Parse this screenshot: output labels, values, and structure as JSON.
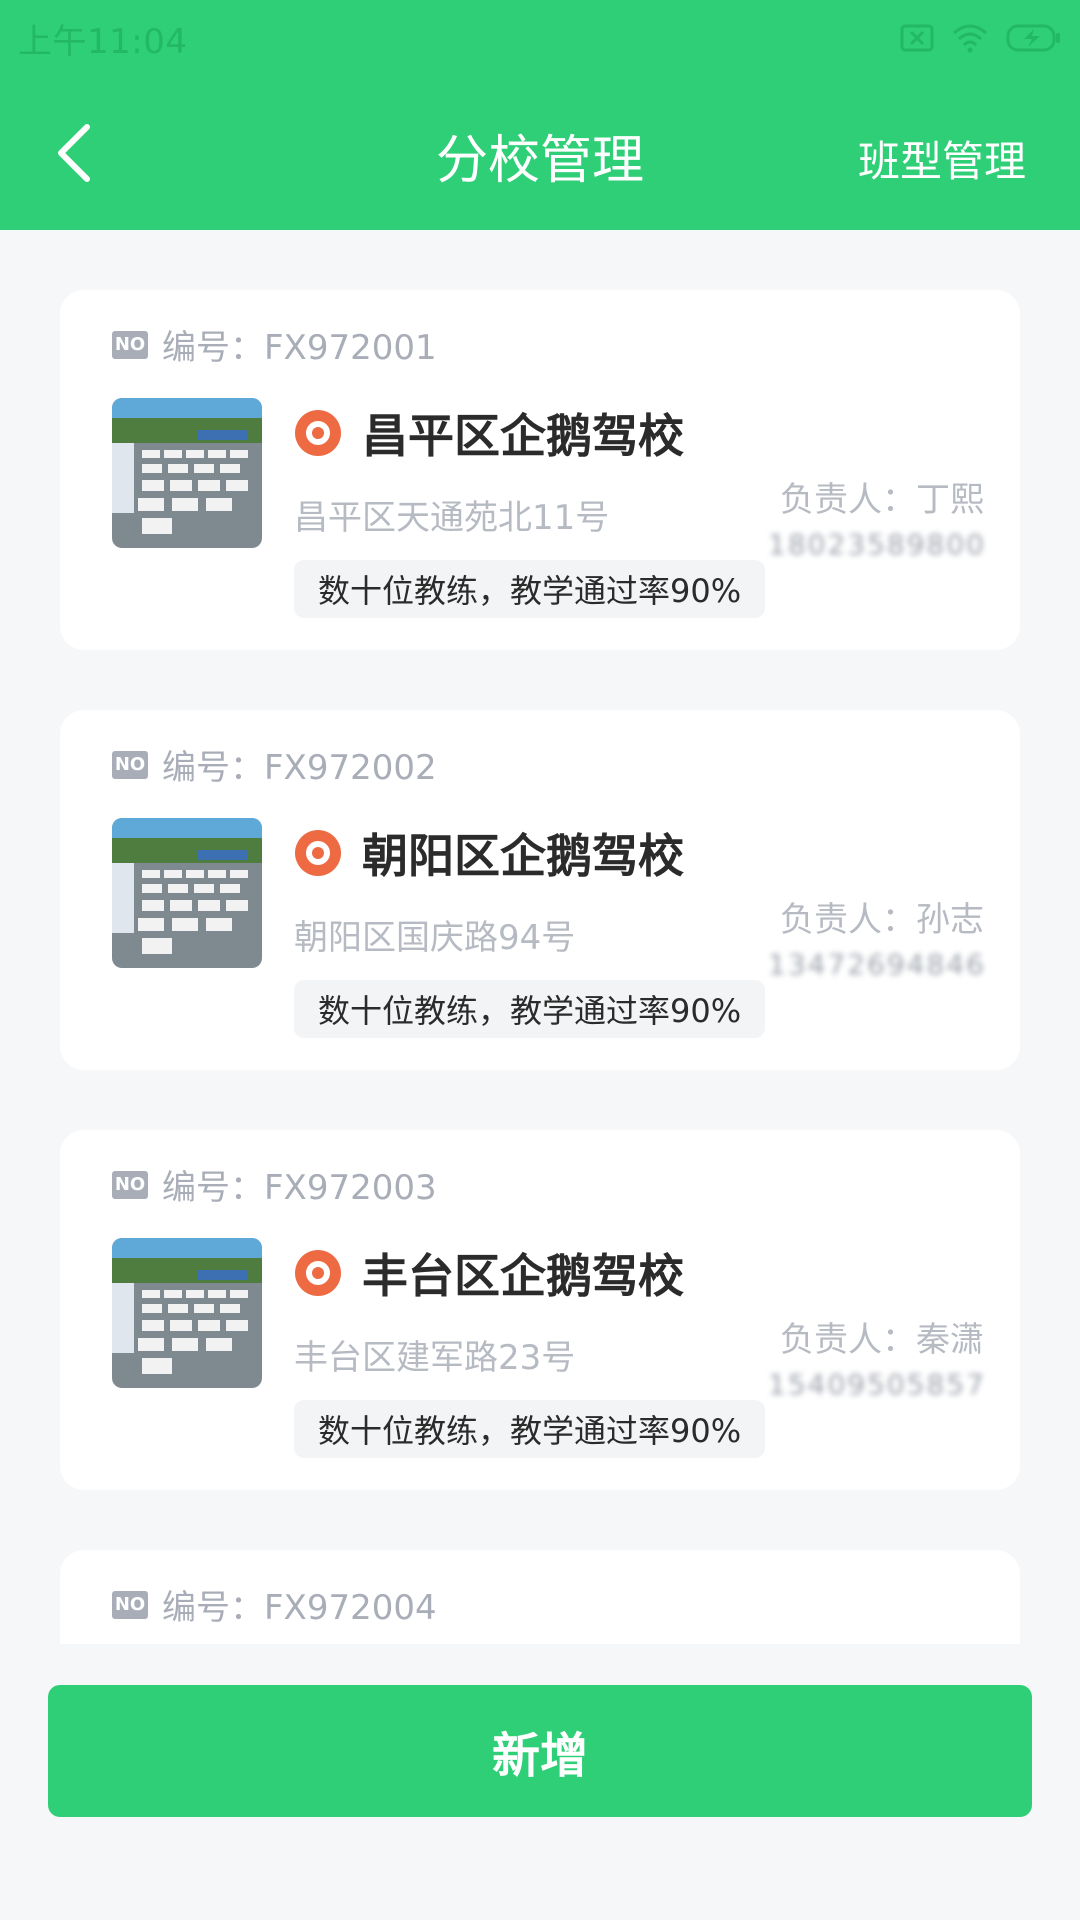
{
  "status_bar": {
    "time": "上午11:04"
  },
  "header": {
    "title": "分校管理",
    "right_action": "班型管理"
  },
  "no_badge": "NO",
  "cards": [
    {
      "no_label": "编号：FX972001",
      "name": "昌平区企鹅驾校",
      "address": "昌平区天通苑北11号",
      "manager": "负责人：丁熙",
      "phone": "18023589800",
      "tag": "数十位教练，教学通过率90%"
    },
    {
      "no_label": "编号：FX972002",
      "name": "朝阳区企鹅驾校",
      "address": "朝阳区国庆路94号",
      "manager": "负责人：孙志",
      "phone": "13472694846",
      "tag": "数十位教练，教学通过率90%"
    },
    {
      "no_label": "编号：FX972003",
      "name": "丰台区企鹅驾校",
      "address": "丰台区建军路23号",
      "manager": "负责人：秦潇",
      "phone": "15409505857",
      "tag": "数十位教练，教学通过率90%"
    },
    {
      "no_label": "编号：FX972004"
    }
  ],
  "add_button": "新增",
  "colors": {
    "primary": "#2ecf76",
    "pin": "#ee6a43",
    "muted": "#a8adb7"
  }
}
